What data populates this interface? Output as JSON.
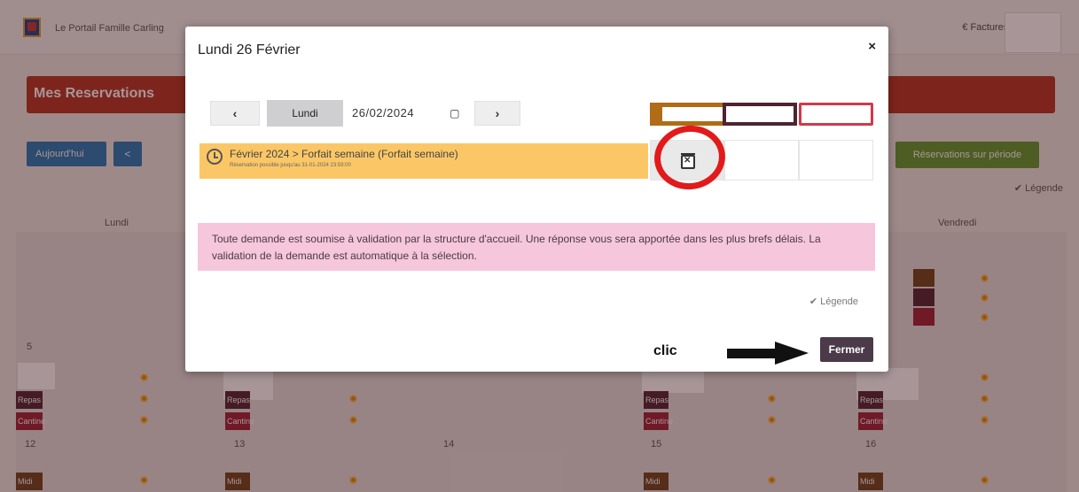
{
  "app": {
    "brand": "Le Portail Famille Carling",
    "top_right": {
      "factures": "€ Factures"
    }
  },
  "background": {
    "section_title": "Mes Reservations",
    "today_button": "Aujourd'hui",
    "prev_button": "<",
    "period_button": "Réservations sur période",
    "legend": "✔ Légende",
    "day_headers": {
      "monday": "Lundi",
      "friday": "Vendredi"
    },
    "day_numbers": [
      "5",
      "12",
      "13",
      "14",
      "15",
      "16"
    ],
    "strip_labels": [
      "Repas",
      "Cantine",
      "Midi"
    ]
  },
  "modal": {
    "title": "Lundi 26 Février",
    "close": "×",
    "nav": {
      "prev": "‹",
      "day": "Lundi",
      "date": "26/02/2024",
      "next": "›"
    },
    "forfait": {
      "title": "Février 2024 > Forfait semaine (Forfait semaine)",
      "subtitle": "Réservation possible jusqu'au 31-01-2024 23:59:00"
    },
    "notice": "Toute demande est soumise à validation par la structure d'accueil. Une réponse vous sera apportée dans les plus brefs délais. La validation de la demande est automatique à la sélection.",
    "legend": "✔ Légende",
    "close_button": "Fermer"
  },
  "annotation": {
    "label": "clic"
  },
  "colors": {
    "overlay": "#3c1419",
    "forfait_bg": "#fbc766",
    "notice_bg": "#f6c6dd",
    "fermer_bg": "#4b3a4a",
    "annotation_red": "#e21a1a"
  }
}
